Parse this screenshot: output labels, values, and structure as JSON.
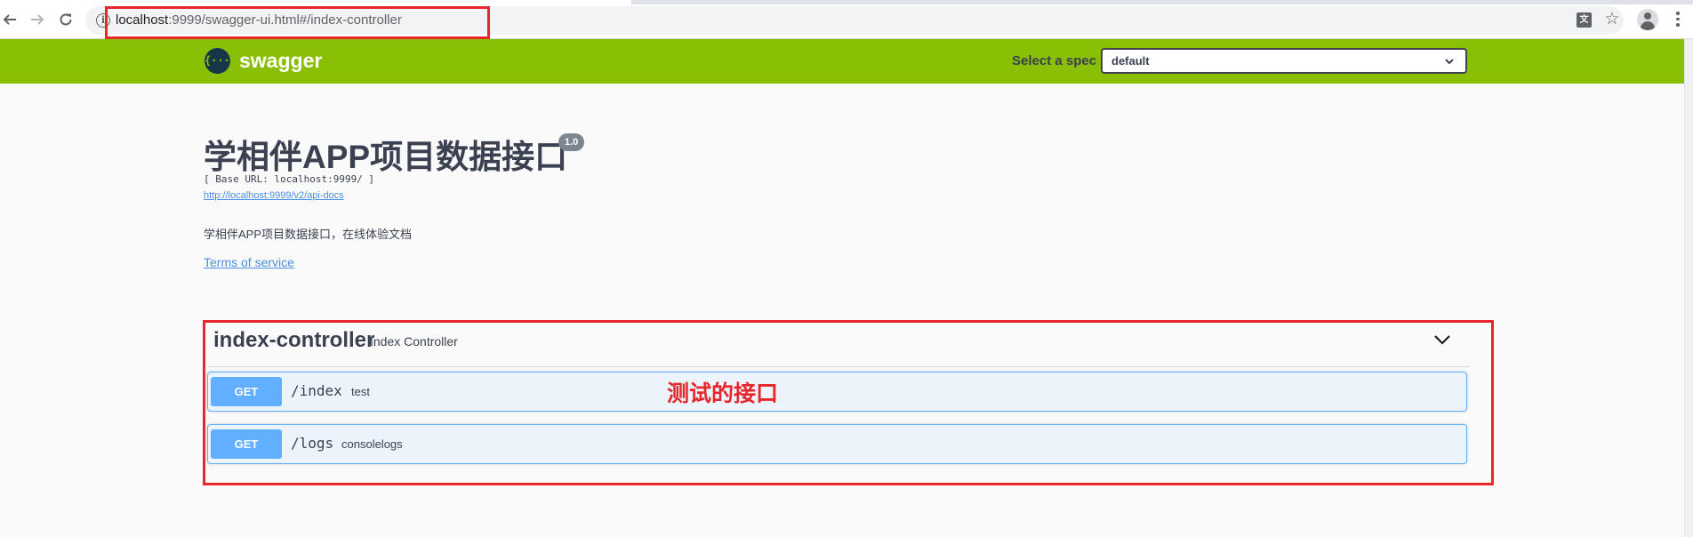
{
  "browser": {
    "back_icon": "arrow-left-icon",
    "forward_icon": "arrow-right-icon",
    "reload_icon": "reload-icon",
    "info_glyph": "i",
    "url_host": "localhost",
    "url_rest": ":9999/swagger-ui.html#/index-controller",
    "translate_glyph": "文",
    "bookmark_glyph": "☆"
  },
  "topbar": {
    "logo_glyph": "{···}",
    "logo_text": "swagger",
    "spec_label": "Select a spec",
    "spec_selected": "default",
    "background": "#89bf04"
  },
  "info": {
    "title": "学相伴APP项目数据接口",
    "version": "1.0",
    "base_url": "[ Base URL: localhost:9999/ ]",
    "docs_link": "http://localhost:9999/v2/api-docs",
    "description": "学相伴APP项目数据接口，在线体验文档",
    "terms_of_service": "Terms of service"
  },
  "tag": {
    "name": "index-controller",
    "description": "Index Controller",
    "expanded": true
  },
  "operations": [
    {
      "method": "GET",
      "path": "/index",
      "summary": "test"
    },
    {
      "method": "GET",
      "path": "/logs",
      "summary": "consolelogs"
    }
  ],
  "annotation": {
    "text": "测试的接口",
    "color": "#e8262b"
  },
  "colors": {
    "get_method": "#61affe",
    "get_background": "#ebf3fb",
    "text": "#3b4151",
    "link": "#4990e2"
  }
}
